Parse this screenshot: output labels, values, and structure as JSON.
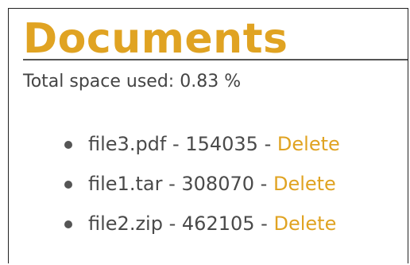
{
  "page": {
    "title": "Documents",
    "space_label": "Total space used:",
    "space_value": "0.83 %"
  },
  "files": [
    {
      "name": "file3.pdf",
      "size": "154035",
      "separator": "-",
      "action": "Delete"
    },
    {
      "name": "file1.tar",
      "size": "308070",
      "separator": "-",
      "action": "Delete"
    },
    {
      "name": "file2.zip",
      "size": "462105",
      "separator": "-",
      "action": "Delete"
    }
  ],
  "colors": {
    "accent": "#e0a322",
    "text": "#4a4a4a",
    "rule": "#555555"
  },
  "icons": {
    "list_bullet": "bullet-icon"
  }
}
